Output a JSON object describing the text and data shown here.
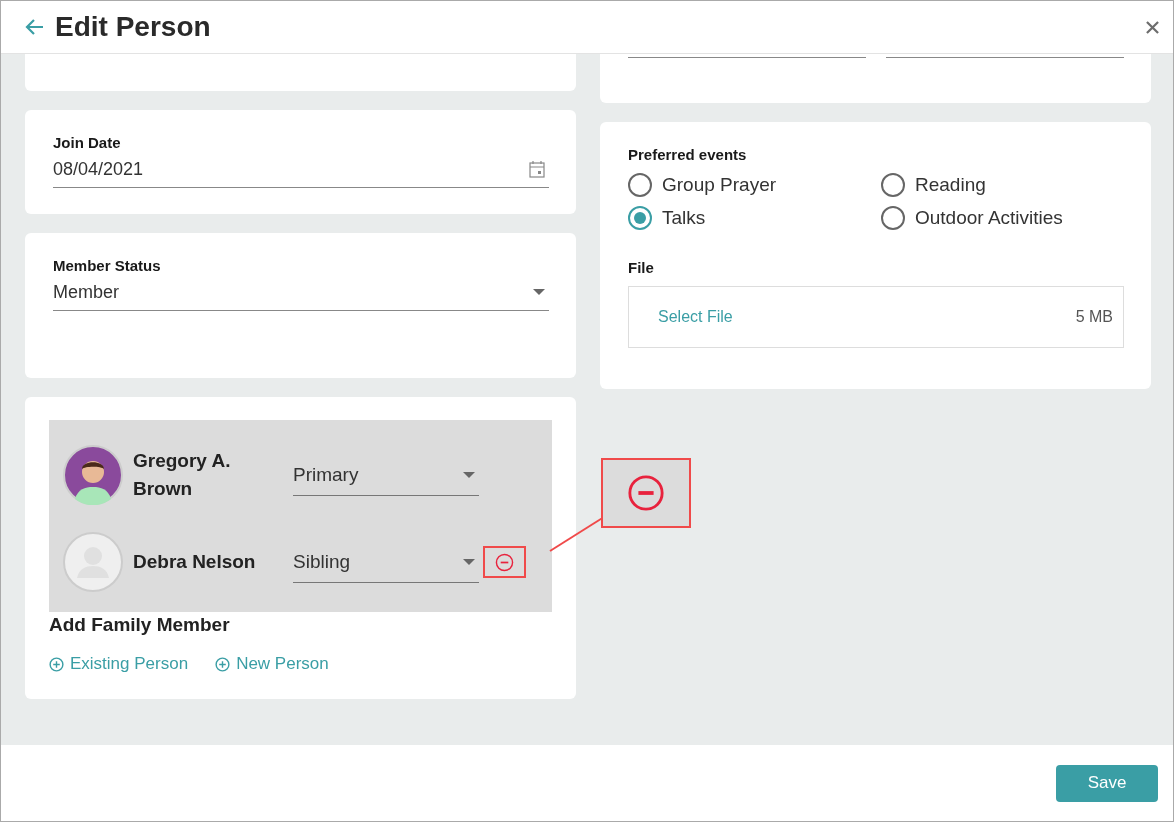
{
  "header": {
    "title": "Edit Person"
  },
  "join_date": {
    "label": "Join Date",
    "value": "08/04/2021"
  },
  "member_status": {
    "label": "Member Status",
    "value": "Member"
  },
  "family": {
    "members": [
      {
        "name": "Gregory A. Brown",
        "kind": "illustrated",
        "relation": "Primary",
        "removable": false,
        "highlighted": false
      },
      {
        "name": "Debra Nelson",
        "kind": "placeholder",
        "relation": "Sibling",
        "removable": true,
        "highlighted": true
      }
    ],
    "add_label": "Add Family Member",
    "add_links": [
      "Existing Person",
      "New Person"
    ]
  },
  "preferred_events": {
    "label": "Preferred events",
    "options": [
      {
        "label": "Group Prayer",
        "selected": false
      },
      {
        "label": "Reading",
        "selected": false
      },
      {
        "label": "Talks",
        "selected": true
      },
      {
        "label": "Outdoor Activities",
        "selected": false
      }
    ]
  },
  "file": {
    "label": "File",
    "action": "Select File",
    "limit": "5 MB"
  },
  "footer": {
    "save": "Save"
  }
}
